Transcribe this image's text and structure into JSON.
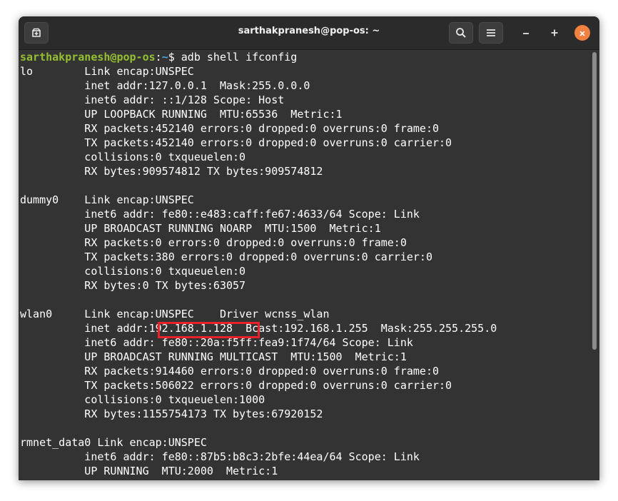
{
  "window": {
    "title": "sarthakpranesh@pop-os: ~",
    "accent_close": "#f0813e"
  },
  "titlebar": {
    "new_tab_icon": "new-tab-icon",
    "search_icon": "search-icon",
    "menu_icon": "hamburger-menu-icon",
    "minimize_icon": "minimize-icon",
    "maximize_icon": "maximize-icon",
    "close_icon": "close-icon"
  },
  "terminal": {
    "prompt_user": "sarthakpranesh@pop-os",
    "prompt_sep": ":",
    "prompt_path": "~",
    "prompt_symbol": "$ ",
    "command": "adb shell ifconfig",
    "highlight_color": "#e8222a",
    "lines": [
      "lo        Link encap:UNSPEC",
      "          inet addr:127.0.0.1  Mask:255.0.0.0",
      "          inet6 addr: ::1/128 Scope: Host",
      "          UP LOOPBACK RUNNING  MTU:65536  Metric:1",
      "          RX packets:452140 errors:0 dropped:0 overruns:0 frame:0",
      "          TX packets:452140 errors:0 dropped:0 overruns:0 carrier:0",
      "          collisions:0 txqueuelen:0",
      "          RX bytes:909574812 TX bytes:909574812",
      "",
      "dummy0    Link encap:UNSPEC",
      "          inet6 addr: fe80::e483:caff:fe67:4633/64 Scope: Link",
      "          UP BROADCAST RUNNING NOARP  MTU:1500  Metric:1",
      "          RX packets:0 errors:0 dropped:0 overruns:0 frame:0",
      "          TX packets:380 errors:0 dropped:0 overruns:0 carrier:0",
      "          collisions:0 txqueuelen:0",
      "          RX bytes:0 TX bytes:63057",
      "",
      "wlan0     Link encap:UNSPEC    Driver wcnss_wlan",
      "          inet addr:192.168.1.128  Bcast:192.168.1.255  Mask:255.255.255.0",
      "          inet6 addr: fe80::20a:f5ff:fea9:1f74/64 Scope: Link",
      "          UP BROADCAST RUNNING MULTICAST  MTU:1500  Metric:1",
      "          RX packets:914460 errors:0 dropped:0 overruns:0 frame:0",
      "          TX packets:506022 errors:0 dropped:0 overruns:0 carrier:0",
      "          collisions:0 txqueuelen:1000",
      "          RX bytes:1155754173 TX bytes:67920152",
      "",
      "rmnet_data0 Link encap:UNSPEC",
      "          inet6 addr: fe80::87b5:b8c3:2bfe:44ea/64 Scope: Link",
      "          UP RUNNING  MTU:2000  Metric:1"
    ]
  }
}
